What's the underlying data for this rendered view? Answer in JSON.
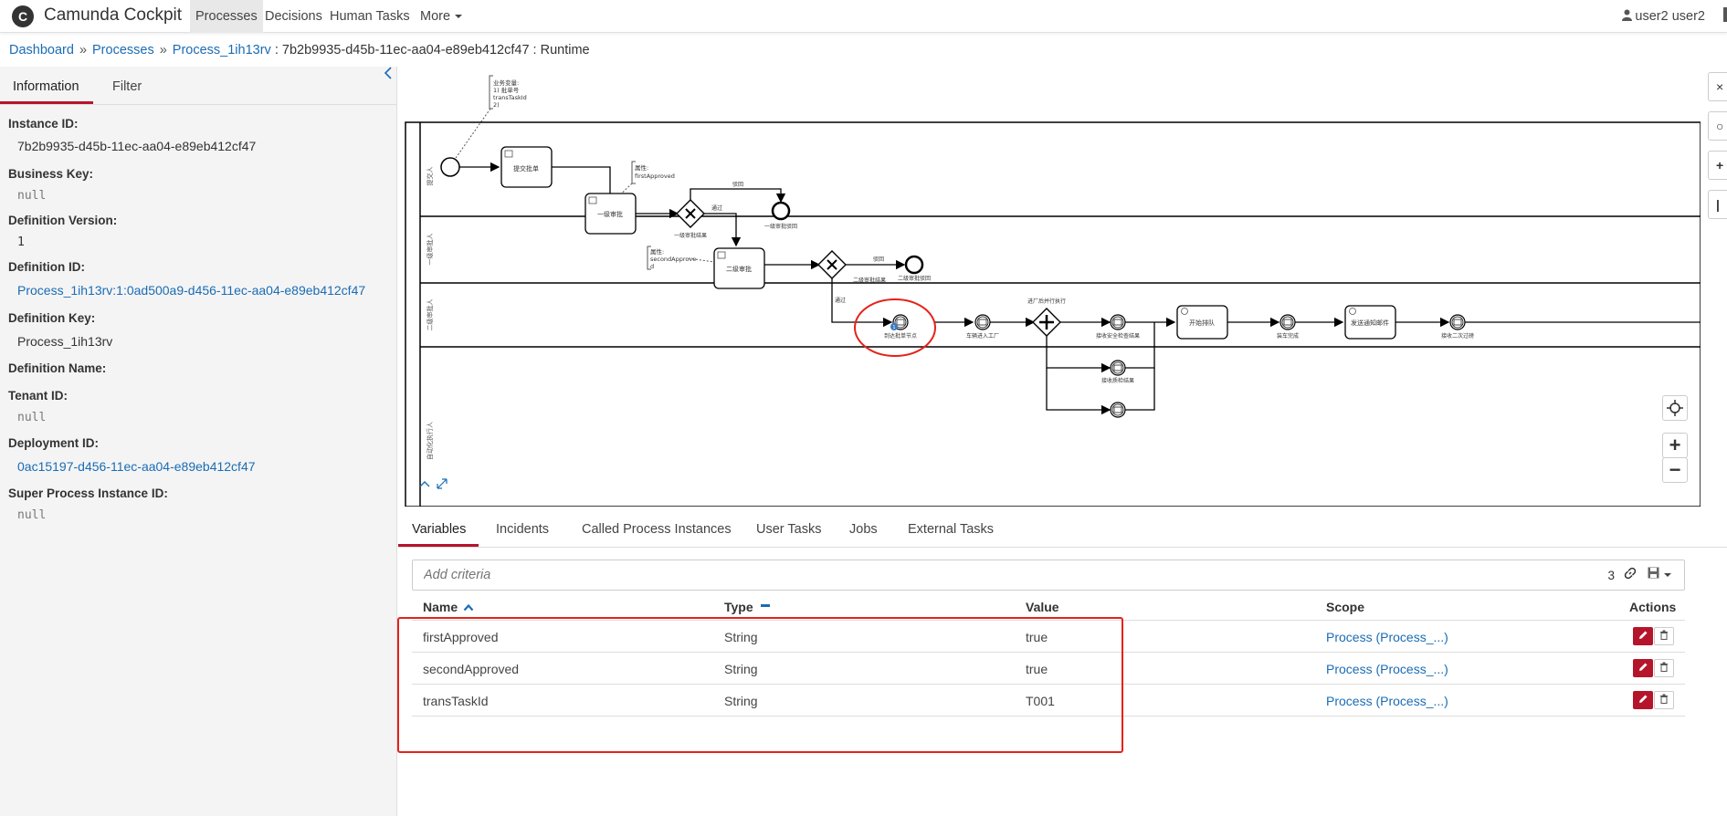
{
  "header": {
    "logo_letter": "C",
    "brand": "Camunda Cockpit",
    "nav": [
      {
        "label": "Processes",
        "active": true
      },
      {
        "label": "Decisions"
      },
      {
        "label": "Human Tasks"
      },
      {
        "label": "More"
      }
    ],
    "user": "user2 user2"
  },
  "breadcrumb": {
    "dashboard": "Dashboard",
    "processes": "Processes",
    "process": "Process_1ih13rv",
    "instance": "7b2b9935-d45b-11ec-aa04-e89eb412cf47 : Runtime"
  },
  "sidebar": {
    "tabs": [
      "Information",
      "Filter"
    ],
    "fields": [
      {
        "label": "Instance ID:",
        "value": "7b2b9935-d45b-11ec-aa04-e89eb412cf47"
      },
      {
        "label": "Business Key:",
        "value": "null"
      },
      {
        "label": "Definition Version:",
        "value": "1"
      },
      {
        "label": "Definition ID:",
        "value": "Process_1ih13rv:1:0ad500a9-d456-11ec-aa04-e89eb412cf47"
      },
      {
        "label": "Definition Key:",
        "value": "Process_1ih13rv"
      },
      {
        "label": "Definition Name:",
        "value": ""
      },
      {
        "label": "Tenant ID:",
        "value": "null"
      },
      {
        "label": "Deployment ID:",
        "value": "0ac15197-d456-11ec-aa04-e89eb412cf47"
      },
      {
        "label": "Super Process Instance ID:",
        "value": "null"
      }
    ]
  },
  "diagram": {
    "annotations": {
      "top": [
        "业务变量:",
        "1) 批单号",
        "transTaskId",
        "2)"
      ],
      "first": [
        "属性:",
        "firstApproved"
      ],
      "second": [
        "属性:",
        "secondApprove",
        "d"
      ]
    },
    "lanes": [
      "提交人",
      "一级审批人",
      "二级审批人",
      "自动化执行人"
    ],
    "tasks": {
      "submit": "提交批单",
      "first_approve": "一级审批",
      "second_approve": "二级审批",
      "start_queue": "开始排队",
      "send_notice": "发送通知邮件"
    },
    "gateways": {
      "first": "一级审批结果",
      "second": "二级审批结果",
      "parallel": "进厂后并行执行"
    },
    "flows": {
      "reject1": "驳回",
      "pass1": "通过",
      "reject2": "驳回",
      "pass2": "通过"
    },
    "events": {
      "end1": "一级审批驳回",
      "end2": "二级审批驳回",
      "msg1": "到达批单节点",
      "msg2": "车辆进入工厂",
      "msg3": "接收安全检查结果",
      "msg4": "接收质检结果",
      "msg5": "装车完成",
      "msg6": "接收二次过磅"
    },
    "token_count": "1"
  },
  "right_tools": [
    "×",
    "○",
    "+",
    "|"
  ],
  "bottom_tabs": [
    "Variables",
    "Incidents",
    "Called Process Instances",
    "User Tasks",
    "Jobs",
    "External Tasks"
  ],
  "search": {
    "placeholder": "Add criteria",
    "count": "3"
  },
  "table": {
    "headers": [
      "Name",
      "Type",
      "Value",
      "Scope",
      "Actions"
    ],
    "rows": [
      {
        "name": "firstApproved",
        "type": "String",
        "value": "true",
        "scope": "Process (Process_...)"
      },
      {
        "name": "secondApproved",
        "type": "String",
        "value": "true",
        "scope": "Process (Process_...)"
      },
      {
        "name": "transTaskId",
        "type": "String",
        "value": "T001",
        "scope": "Process (Process_...)"
      }
    ]
  },
  "colors": {
    "accent": "#b5152b",
    "link": "#1a6cb5",
    "highlight": "#e5211a"
  }
}
